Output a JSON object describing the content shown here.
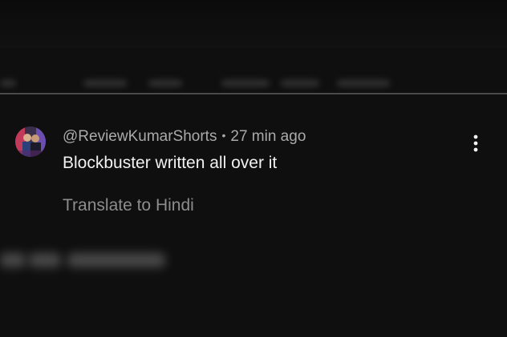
{
  "comment": {
    "author": "@ReviewKumarShorts",
    "separator": "•",
    "time": "27 min ago",
    "text": "Blockbuster written all over it",
    "translate_label": "Translate to Hindi",
    "more_icon": "more-vertical-icon"
  },
  "colors": {
    "background": "#0f0f0f",
    "primary_text": "#f1f1f1",
    "secondary_text": "#aaaaaa",
    "translate_text": "#8d8d8d",
    "divider": "#4a4a4a"
  }
}
